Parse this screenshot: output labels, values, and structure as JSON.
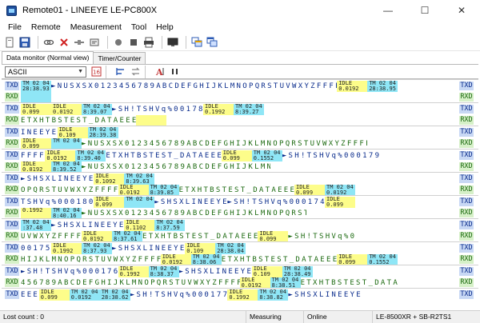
{
  "window": {
    "title": "Remote01 - LINEEYE LE-PC800X",
    "minimize": "—",
    "maximize": "☐",
    "close": "✕"
  },
  "menu": [
    "File",
    "Remote",
    "Measurement",
    "Tool",
    "Help"
  ],
  "toolbar_icons": [
    "new-icon",
    "save-icon",
    "link-icon",
    "disconnect-icon",
    "connect-icon",
    "settings-icon",
    "stop-icon",
    "record-icon",
    "print-icon",
    "monitor-icon",
    "window-icon",
    "cascade-icon"
  ],
  "tabs": {
    "data_monitor": "Data monitor (Normal view)",
    "timer_counter": "Timer/Counter"
  },
  "panel": {
    "encoding": "ASCII"
  },
  "monitor": {
    "rows": [
      {
        "line": "TXD",
        "segments": [
          {
            "k": "time",
            "t1": "TM 02 04",
            "t2": "28:38.93"
          },
          {
            "k": "text",
            "s": "tx",
            "v": "►NUSXSX0123456789ABCDEFGHIJKLMNOPQRSTUVWXYZFFFF"
          },
          {
            "k": "idle",
            "t1": "IDLE",
            "t2": "0.0192"
          },
          {
            "k": "time",
            "t1": "TM 02 04",
            "t2": "28:38.95"
          }
        ]
      },
      {
        "line": "RXD",
        "segments": [
          {
            "k": "time",
            "t1": "",
            "t2": ""
          }
        ]
      },
      {
        "line": "TXD",
        "segments": [
          {
            "k": "idle",
            "t1": "IDLE",
            "t2": "0.099"
          },
          {
            "k": "idle",
            "t1": "IDLE",
            "t2": "0.0192"
          },
          {
            "k": "time",
            "t1": "TM 02 04",
            "t2": "8:39.07"
          },
          {
            "k": "text",
            "s": "tx",
            "v": "►SH!TSHVq%00178"
          },
          {
            "k": "idle",
            "t1": "IDLE",
            "t2": "0.1992"
          },
          {
            "k": "time",
            "t1": "TM 02 04",
            "t2": "8:39.27"
          }
        ]
      },
      {
        "line": "RXD",
        "segments": [
          {
            "k": "text",
            "s": "rx",
            "v": "ETXHTBSTEST_DATAEEE"
          },
          {
            "k": "idle",
            "t1": "",
            "t2": ""
          }
        ]
      },
      {
        "line": "TXD",
        "segments": [
          {
            "k": "text",
            "s": "tx",
            "v": "INEEYE"
          },
          {
            "k": "idle",
            "t1": "IDLE",
            "t2": "0.109"
          },
          {
            "k": "time",
            "t1": "TM 02 04",
            "t2": "28:39.38"
          }
        ]
      },
      {
        "line": "RXD",
        "segments": [
          {
            "k": "idle",
            "t1": "IDLE",
            "t2": "0.099"
          },
          {
            "k": "time",
            "t1": "TM 02 04",
            "t2": ""
          },
          {
            "k": "text",
            "s": "rx",
            "v": "►NUSXSX0123456789ABCDEFGHIJKLMNOPQRSTUVWXYZFFFF"
          }
        ]
      },
      {
        "line": "TXD",
        "segments": [
          {
            "k": "text",
            "s": "tx",
            "v": "FFFF"
          },
          {
            "k": "idle",
            "t1": "IDLE",
            "t2": "0.0192"
          },
          {
            "k": "time",
            "t1": "TM 02 04",
            "t2": "8:39.40"
          },
          {
            "k": "text",
            "s": "tx",
            "v": "ETXHTBSTEST_DATAEEE"
          },
          {
            "k": "idle",
            "t1": "IDLE",
            "t2": "0.099"
          },
          {
            "k": "time",
            "t1": "TM 02 04",
            "t2": "0.1552"
          },
          {
            "k": "text",
            "s": "tx",
            "v": "►SH!TSHVq%000179"
          }
        ]
      },
      {
        "line": "RXD",
        "segments": [
          {
            "k": "idle",
            "t1": "IDLE",
            "t2": "0.0192"
          },
          {
            "k": "time",
            "t1": "TM 02 04",
            "t2": "8:39.52"
          },
          {
            "k": "text",
            "s": "rx",
            "v": "►NUSXSX0123456789ABCDEFGHIJKLMN"
          }
        ]
      },
      {
        "line": "TXD",
        "segments": [
          {
            "k": "text",
            "s": "tx",
            "v": "►SHSXLINEEYE"
          },
          {
            "k": "idle",
            "t1": "IDLE",
            "t2": "0.1092"
          },
          {
            "k": "time",
            "t1": "TM 02 04",
            "t2": "8:39.63"
          }
        ]
      },
      {
        "line": "RXD",
        "segments": [
          {
            "k": "text",
            "s": "rx",
            "v": "OPQRSTUVWXYZFFFF"
          },
          {
            "k": "idle",
            "t1": "IDLE",
            "t2": "0.0192"
          },
          {
            "k": "time",
            "t1": "TM 02 04",
            "t2": "8:39.85"
          },
          {
            "k": "text",
            "s": "rx",
            "v": "ETXHTBSTEST_DATAEEE"
          },
          {
            "k": "idle",
            "t1": "IDLE",
            "t2": "0.099"
          },
          {
            "k": "time",
            "t1": "TM 02 04",
            "t2": "0.0192"
          }
        ]
      },
      {
        "line": "TXD",
        "segments": [
          {
            "k": "text",
            "s": "tx",
            "v": "TSHVq%000180"
          },
          {
            "k": "idle",
            "t1": "IDLE",
            "t2": "0.099"
          },
          {
            "k": "time",
            "t1": "TM 02 04",
            "t2": ""
          },
          {
            "k": "text",
            "s": "tx",
            "v": "►SHSXLINEEYE"
          },
          {
            "k": "text",
            "s": "tx",
            "v": "►SH!TSHVq%000174"
          },
          {
            "k": "idle",
            "t1": "IDLE",
            "t2": "0.099"
          }
        ]
      },
      {
        "line": "RXD",
        "segments": [
          {
            "k": "idle",
            "t1": "",
            "t2": "0.1992"
          },
          {
            "k": "time",
            "t1": "TM 02 04",
            "t2": "8:40.16"
          },
          {
            "k": "text",
            "s": "rx",
            "v": "►NUSXSX0123456789ABCDEFGHIJKLMNOPQRST"
          }
        ]
      },
      {
        "line": "TXD",
        "segments": [
          {
            "k": "time",
            "t1": "TM 02 04",
            "t2": ":37.48"
          },
          {
            "k": "text",
            "s": "tx",
            "v": "►SHSXLINEEYE"
          },
          {
            "k": "idle",
            "t1": "IDLE",
            "t2": "0.1102"
          },
          {
            "k": "time",
            "t1": "TM 02 04",
            "t2": "8:37.59"
          }
        ]
      },
      {
        "line": "RXD",
        "segments": [
          {
            "k": "text",
            "s": "rx",
            "v": "UVWXYZFFFF"
          },
          {
            "k": "idle",
            "t1": "IDLE",
            "t2": "0.0192"
          },
          {
            "k": "time",
            "t1": "TM 02 04",
            "t2": "8:37.61"
          },
          {
            "k": "text",
            "s": "rx",
            "v": "ETXHTBSTEST_DATAEEE"
          },
          {
            "k": "idle",
            "t1": "IDLE",
            "t2": "0.099"
          },
          {
            "k": "text",
            "s": "rx",
            "v": "►SH!TSHVq%0"
          }
        ]
      },
      {
        "line": "TXD",
        "segments": [
          {
            "k": "text",
            "s": "tx",
            "v": "00175"
          },
          {
            "k": "idle",
            "t1": "IDLE",
            "t2": "0.1992"
          },
          {
            "k": "time",
            "t1": "TM 02 04",
            "t2": "8:37.93"
          },
          {
            "k": "text",
            "s": "tx",
            "v": "►SHSXLINEEYE"
          },
          {
            "k": "idle",
            "t1": "IDLE",
            "t2": "0.109"
          },
          {
            "k": "time",
            "t1": "TM 02 04",
            "t2": "28:38.04"
          }
        ]
      },
      {
        "line": "RXD",
        "segments": [
          {
            "k": "text",
            "s": "rx",
            "v": "HIJKLMNOPQRSTUVWXYZFFFF"
          },
          {
            "k": "idle",
            "t1": "IDLE",
            "t2": "0.0192"
          },
          {
            "k": "time",
            "t1": "TM 02 04",
            "t2": "8:38.06"
          },
          {
            "k": "text",
            "s": "rx",
            "v": "ETXHTBSTEST_DATAEEE"
          },
          {
            "k": "idle",
            "t1": "IDLE",
            "t2": "0.099"
          },
          {
            "k": "time",
            "t1": "TM 02 04",
            "t2": "0.1552"
          }
        ]
      },
      {
        "line": "TXD",
        "segments": [
          {
            "k": "text",
            "s": "tx",
            "v": "►SH!TSHVq%000176"
          },
          {
            "k": "idle",
            "t1": "IDLE",
            "t2": "0.1992"
          },
          {
            "k": "time",
            "t1": "TM 02 04",
            "t2": "8:38.37"
          },
          {
            "k": "text",
            "s": "tx",
            "v": "►SHSXLINEEYE"
          },
          {
            "k": "idle",
            "t1": "IDLE",
            "t2": "0.109"
          },
          {
            "k": "time",
            "t1": "TM 02 04",
            "t2": "28:38.49"
          }
        ]
      },
      {
        "line": "RXD",
        "segments": [
          {
            "k": "text",
            "s": "rx",
            "v": "456789ABCDEFGHIJKLMNOPQRSTUVWXYZFFFF"
          },
          {
            "k": "idle",
            "t1": "IDLE",
            "t2": "0.0192"
          },
          {
            "k": "time",
            "t1": "TM 02 04",
            "t2": "8:38.51"
          },
          {
            "k": "text",
            "s": "rx",
            "v": "ETXHTBSTEST_DATA"
          }
        ]
      },
      {
        "line": "TXD",
        "segments": [
          {
            "k": "text",
            "s": "tx",
            "v": "EEE"
          },
          {
            "k": "idle",
            "t1": "IDLE",
            "t2": "0.099"
          },
          {
            "k": "time",
            "t1": "TM 02 04",
            "t2": "0.0192"
          },
          {
            "k": "time",
            "t1": "TM 02 04",
            "t2": "28:38.62"
          },
          {
            "k": "text",
            "s": "tx",
            "v": "►SH!TSHVq%000177"
          },
          {
            "k": "idle",
            "t1": "IDLE",
            "t2": "0.1992"
          },
          {
            "k": "time",
            "t1": "TM 02 04",
            "t2": "8:38.82"
          },
          {
            "k": "text",
            "s": "tx",
            "v": "►SHSXLINEEYE"
          }
        ]
      }
    ]
  },
  "status": {
    "lost_count": "Lost count : 0",
    "state": "Measuring",
    "connection": "Online",
    "device": "LE-8500XR + SB-R2TS1"
  }
}
